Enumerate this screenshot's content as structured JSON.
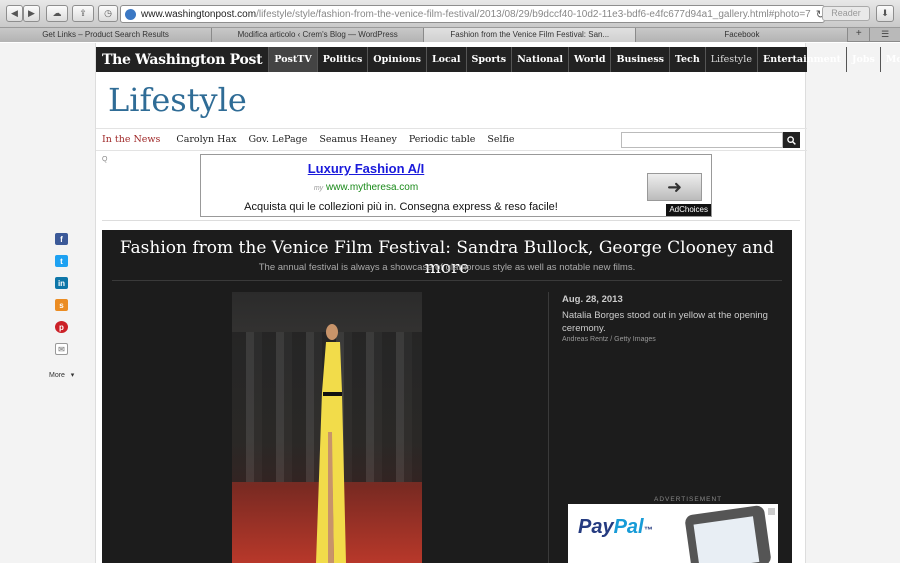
{
  "browser": {
    "url_host": "www.washingtonpost.com",
    "url_path": "/lifestyle/style/fashion-from-the-venice-film-festival/2013/08/29/b9dccf40-10d2-11e3-bdf6-e4fc677d94a1_gallery.html#photo=7",
    "reader_label": "Reader",
    "tabs": [
      "Get Links – Product Search Results",
      "Modifica articolo ‹ Crem's Blog — WordPress",
      "Fashion from the Venice Film Festival: San...",
      "Facebook"
    ],
    "new_tab": "+",
    "tab_menu": "☰"
  },
  "site": {
    "logo": "The Washington Post",
    "nav": [
      "PostTV",
      "Politics",
      "Opinions",
      "Local",
      "Sports",
      "National",
      "World",
      "Business",
      "Tech",
      "Lifestyle",
      "Entertainment",
      "Jobs",
      "More"
    ],
    "section_title": "Lifestyle",
    "subnav_lead": "In the News",
    "subnav_links": [
      "Carolyn Hax",
      "Gov. LePage",
      "Seamus Heaney",
      "Periodic table",
      "Selfie"
    ]
  },
  "ad": {
    "headline": "Luxury Fashion A/I",
    "site_prefix": "my",
    "site": "www.mytheresa.com",
    "body": "Acquista qui le collezioni più in. Consegna express & reso facile!",
    "adchoices": "AdChoices",
    "marker": "Q"
  },
  "gallery": {
    "title": "Fashion from the Venice Film Festival: Sandra Bullock, George Clooney and more",
    "subtitle": "The annual festival is always a showcase of glamorous style as well as notable new films.",
    "date": "Aug. 28, 2013",
    "caption": "Natalia Borges stood out in yellow at the opening ceremony.",
    "credit": "Andreas Rentz / Getty Images",
    "advertisement_label": "ADVERTISEMENT",
    "paypal_pay": "Pay",
    "paypal_pal": "Pal",
    "paypal_tm": "™"
  },
  "share": {
    "more_label": "More",
    "more_caret": "▾"
  },
  "colors": {
    "section_blue": "#2f6c96",
    "nav_bg": "#222222",
    "in_the_news": "#a02a2a",
    "facebook": "#3b5998",
    "twitter": "#1da1f2",
    "linkedin": "#0e76a8",
    "stumbleupon": "#eb8c22",
    "pinterest": "#cb2027"
  }
}
